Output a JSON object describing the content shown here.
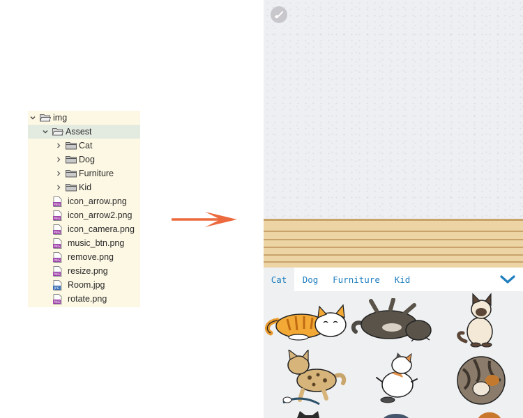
{
  "file_tree": {
    "root": "img",
    "folder": "Assest",
    "subfolders": [
      "Cat",
      "Dog",
      "Furniture",
      "Kid"
    ],
    "files": [
      {
        "name": "icon_arrow.png",
        "type": "png"
      },
      {
        "name": "icon_arrow2.png",
        "type": "png"
      },
      {
        "name": "icon_camera.png",
        "type": "png"
      },
      {
        "name": "music_btn.png",
        "type": "png"
      },
      {
        "name": "remove.png",
        "type": "png"
      },
      {
        "name": "resize.png",
        "type": "png"
      },
      {
        "name": "Room.jpg",
        "type": "jpg"
      },
      {
        "name": "rotate.png",
        "type": "png"
      }
    ]
  },
  "arrow": {
    "color": "#ec6a3e"
  },
  "app": {
    "tabs": [
      "Cat",
      "Dog",
      "Furniture",
      "Kid"
    ],
    "active_tab": "Cat",
    "accent_color": "#1f7fbf",
    "icons": {
      "music": "music-note-icon",
      "collapse": "chevron-down-icon"
    },
    "stickers": [
      "orange-tabby-cat",
      "gray-cat-rolling",
      "siamese-cat-sitting",
      "spotted-cat-walking",
      "calico-cat-lying",
      "tabby-cat-curled",
      "black-cat-partial",
      "gray-cat-partial",
      "orange-cat-partial"
    ]
  }
}
